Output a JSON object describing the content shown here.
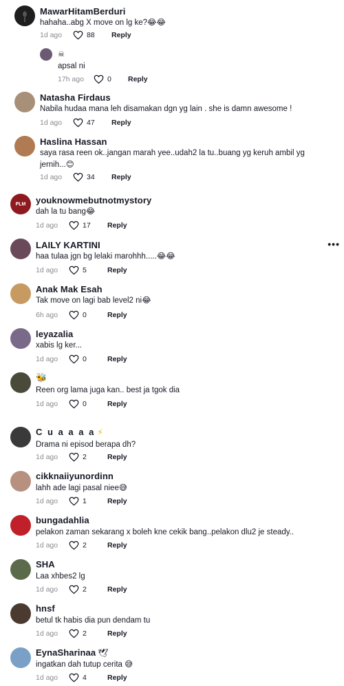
{
  "comments": [
    {
      "user": "MawarHitamBerduri",
      "badge": "",
      "text": "hahaha..abg X move on lg ke?😂😂",
      "time": "1d ago",
      "likes": "88",
      "reply": "Reply",
      "avatar_color": "#2b2b2b"
    },
    {
      "user": "",
      "badge": "☠",
      "text": "apsal ni",
      "time": "17h ago",
      "likes": "0",
      "reply": "Reply",
      "avatar_color": "#6b5a72"
    },
    {
      "user": "Natasha Firdaus",
      "badge": "",
      "text": "Nabila hudaa mana leh disamakan dgn yg lain . she is damn awesome !",
      "time": "1d ago",
      "likes": "47",
      "reply": "Reply",
      "avatar_color": "#a89078"
    },
    {
      "user": "Haslina Hassan",
      "badge": "",
      "text": "saya rasa reen ok..jangan marah yee..udah2 la tu..buang yg keruh ambil yg jernih...😊",
      "time": "1d ago",
      "likes": "34",
      "reply": "Reply",
      "avatar_color": "#b07a52"
    },
    {
      "user": "youknowmebutnotmystory",
      "badge": "",
      "text": "dah la tu bang😂",
      "time": "1d ago",
      "likes": "17",
      "reply": "Reply",
      "avatar_color": "#8e1a1f",
      "avatar_text": "PLM"
    },
    {
      "user": "LAILY KARTINI",
      "badge": "",
      "text": "haa tulaa jgn bg lelaki marohhh.....😂😂",
      "time": "1d ago",
      "likes": "5",
      "reply": "Reply",
      "avatar_color": "#6a4a5a"
    },
    {
      "user": "Anak Mak Esah",
      "badge": "",
      "text": "Tak move on lagi bab level2 ni😂",
      "time": "6h ago",
      "likes": "0",
      "reply": "Reply",
      "avatar_color": "#c79a62"
    },
    {
      "user": "leyazalia",
      "badge": "",
      "text": "xabis lg ker...",
      "time": "1d ago",
      "likes": "0",
      "reply": "Reply",
      "avatar_color": "#7a6a8a"
    },
    {
      "user": "",
      "badge": "🐝",
      "text": "Reen org lama juga kan.. best ja tgok dia",
      "time": "1d ago",
      "likes": "0",
      "reply": "Reply",
      "avatar_color": "#4a4a3a"
    },
    {
      "user": "C u a a a a",
      "badge": "⚡",
      "text": "Drama ni episod berapa dh?",
      "time": "1d ago",
      "likes": "2",
      "reply": "Reply",
      "avatar_color": "#3a3a3a"
    },
    {
      "user": "cikknaiiyunordinn",
      "badge": "",
      "text": "lahh ade lagi pasal niee😅",
      "time": "1d ago",
      "likes": "1",
      "reply": "Reply",
      "avatar_color": "#b89080"
    },
    {
      "user": "bungadahlia",
      "badge": "",
      "text": "pelakon zaman sekarang x boleh kne cekik bang..pelakon dlu2 je steady..",
      "time": "1d ago",
      "likes": "2",
      "reply": "Reply",
      "avatar_color": "#c0202a"
    },
    {
      "user": "SHA",
      "badge": "",
      "text": "Laa xhbes2 lg",
      "time": "1d ago",
      "likes": "2",
      "reply": "Reply",
      "avatar_color": "#5a6a4a"
    },
    {
      "user": "hnsf",
      "badge": "",
      "text": "betul tk habis dia pun dendam tu",
      "time": "1d ago",
      "likes": "2",
      "reply": "Reply",
      "avatar_color": "#4a3a30"
    },
    {
      "user": "EynaSharinaa",
      "badge": "🕊",
      "text": "ingatkan dah tutup cerita 😅",
      "time": "1d ago",
      "likes": "4",
      "reply": "Reply",
      "avatar_color": "#7aa0c8"
    }
  ]
}
